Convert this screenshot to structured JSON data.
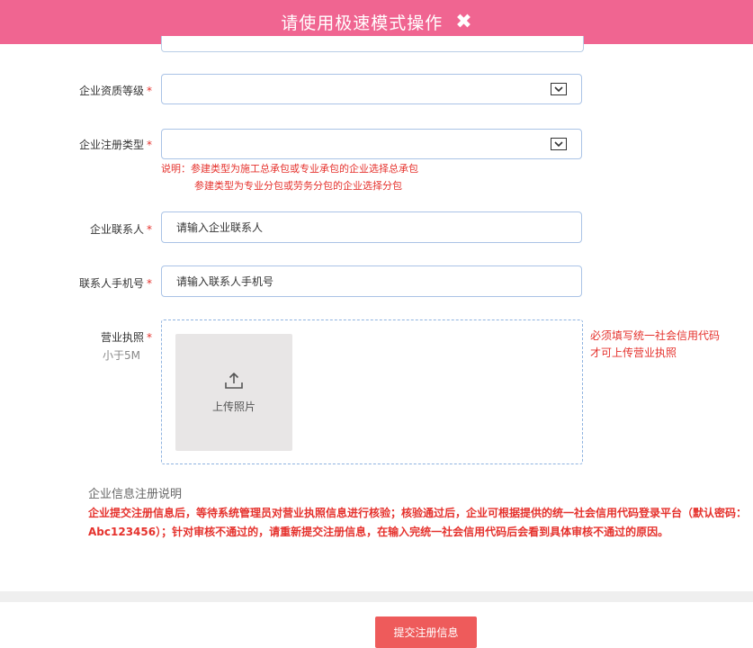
{
  "header": {
    "title": "请使用极速模式操作",
    "close_icon": "close-icon"
  },
  "form": {
    "qualification": {
      "label": "企业资质等级",
      "required": "*",
      "value": ""
    },
    "registration_type": {
      "label": "企业注册类型",
      "required": "*",
      "value": ""
    },
    "type_note": {
      "line1": "说明：参建类型为施工总承包或专业承包的企业选择总承包",
      "line2": "参建类型为专业分包或劳务分包的企业选择分包"
    },
    "contact": {
      "label": "企业联系人",
      "required": "*",
      "value": "请输入企业联系人"
    },
    "phone": {
      "label": "联系人手机号",
      "required": "*",
      "value": "请输入联系人手机号"
    },
    "license": {
      "label": "营业执照",
      "required": "*",
      "size_hint": "小于5M",
      "upload_label": "上传照片",
      "upload_icon": "upload-icon",
      "side_note_line1": "必须填写统一社会信用代码",
      "side_note_line2": "才可上传营业执照"
    }
  },
  "info": {
    "title": "企业信息注册说明",
    "text": "企业提交注册信息后，等待系统管理员对营业执照信息进行核验；核验通过后，企业可根据提供的统一社会信用代码登录平台（默认密码：Abc123456）；针对审核不通过的，请重新提交注册信息，在输入完统一社会信用代码后会看到具体审核不通过的原因。"
  },
  "actions": {
    "submit_label": "提交注册信息"
  },
  "colors": {
    "banner": "#f06591",
    "accent_red": "#e5322d",
    "submit": "#ee5b5b",
    "field_border": "#aac3e6"
  }
}
